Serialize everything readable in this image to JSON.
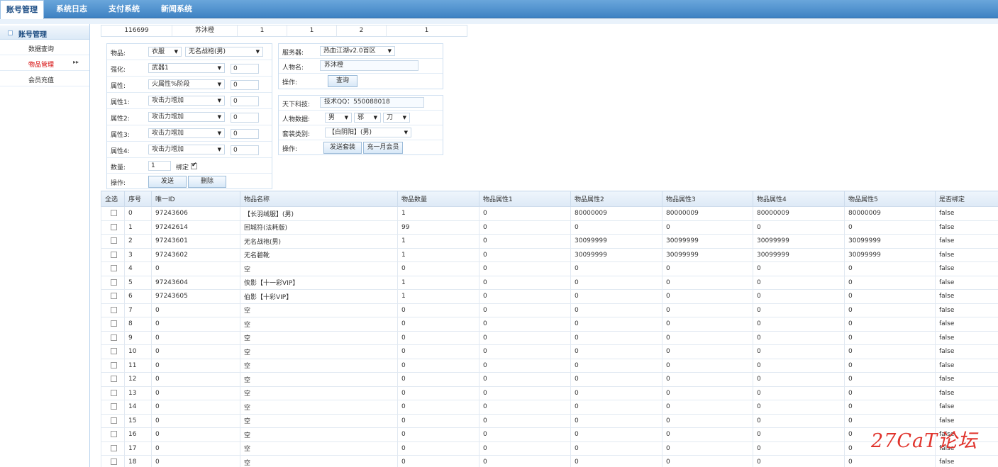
{
  "nav": {
    "tabs": [
      "账号管理",
      "系统日志",
      "支付系统",
      "新闻系统"
    ]
  },
  "sidebar": {
    "title": "账号管理",
    "items": [
      {
        "label": "数据查询"
      },
      {
        "label": "物品管理"
      },
      {
        "label": "会员充值"
      }
    ]
  },
  "info_strip": [
    "116699",
    "苏沐橙",
    "1",
    "1",
    "2",
    "1"
  ],
  "item_form": {
    "item_label": "物品:",
    "item_category": "衣服",
    "item_name": "无名战袍(男)",
    "enhance_label": "强化:",
    "enhance_select": "武器1",
    "enhance_value": "0",
    "attr_label": "属性:",
    "attr_select": "火属性%阶段",
    "attr_value": "0",
    "attr1_label": "属性1:",
    "attr1_select": "攻击力增加",
    "attr1_value": "0",
    "attr2_label": "属性2:",
    "attr2_select": "攻击力增加",
    "attr2_value": "0",
    "attr3_label": "属性3:",
    "attr3_select": "攻击力增加",
    "attr3_value": "0",
    "attr4_label": "属性4:",
    "attr4_select": "攻击力增加",
    "attr4_value": "0",
    "qty_label": "数量:",
    "qty_value": "1",
    "bind_label": "绑定",
    "bind_checked": true,
    "op_label": "操作:",
    "send_button": "发送",
    "delete_button": "删除"
  },
  "server_form": {
    "server_label": "服务器:",
    "server_value": "热血江湖v2.0首区",
    "name_label": "人物名:",
    "name_value": "苏沐橙",
    "op_label": "操作:",
    "query_button": "查询"
  },
  "suit_form": {
    "tech_label": "天下科技:",
    "tech_value": "技术QQ：550088018",
    "data_label": "人物数据:",
    "gender": "男",
    "faction": "邪",
    "weapon": "刀",
    "suit_label": "套装类别:",
    "suit_value": "【白阴阳】(男)",
    "op_label": "操作:",
    "send_suit_button": "发送套装",
    "vip_button": "充一月会员"
  },
  "table": {
    "headers": [
      "全选",
      "序号",
      "唯一ID",
      "物品名称",
      "物品数量",
      "物品属性1",
      "物品属性2",
      "物品属性3",
      "物品属性4",
      "物品属性5",
      "是否绑定"
    ],
    "rows": [
      [
        "0",
        "97243606",
        "【长羽绒服】(男)",
        "1",
        "0",
        "80000009",
        "80000009",
        "80000009",
        "80000009",
        "false"
      ],
      [
        "1",
        "97242614",
        "回城符(法耗版)",
        "99",
        "0",
        "0",
        "0",
        "0",
        "0",
        "false"
      ],
      [
        "2",
        "97243601",
        "无名战袍(男)",
        "1",
        "0",
        "30099999",
        "30099999",
        "30099999",
        "30099999",
        "false"
      ],
      [
        "3",
        "97243602",
        "无名碧靴",
        "1",
        "0",
        "30099999",
        "30099999",
        "30099999",
        "30099999",
        "false"
      ],
      [
        "4",
        "0",
        "空",
        "0",
        "0",
        "0",
        "0",
        "0",
        "0",
        "false"
      ],
      [
        "5",
        "97243604",
        "侠影【十一彩VIP】",
        "1",
        "0",
        "0",
        "0",
        "0",
        "0",
        "false"
      ],
      [
        "6",
        "97243605",
        "伯影【十彩VIP】",
        "1",
        "0",
        "0",
        "0",
        "0",
        "0",
        "false"
      ],
      [
        "7",
        "0",
        "空",
        "0",
        "0",
        "0",
        "0",
        "0",
        "0",
        "false"
      ],
      [
        "8",
        "0",
        "空",
        "0",
        "0",
        "0",
        "0",
        "0",
        "0",
        "false"
      ],
      [
        "9",
        "0",
        "空",
        "0",
        "0",
        "0",
        "0",
        "0",
        "0",
        "false"
      ],
      [
        "10",
        "0",
        "空",
        "0",
        "0",
        "0",
        "0",
        "0",
        "0",
        "false"
      ],
      [
        "11",
        "0",
        "空",
        "0",
        "0",
        "0",
        "0",
        "0",
        "0",
        "false"
      ],
      [
        "12",
        "0",
        "空",
        "0",
        "0",
        "0",
        "0",
        "0",
        "0",
        "false"
      ],
      [
        "13",
        "0",
        "空",
        "0",
        "0",
        "0",
        "0",
        "0",
        "0",
        "false"
      ],
      [
        "14",
        "0",
        "空",
        "0",
        "0",
        "0",
        "0",
        "0",
        "0",
        "false"
      ],
      [
        "15",
        "0",
        "空",
        "0",
        "0",
        "0",
        "0",
        "0",
        "0",
        "false"
      ],
      [
        "16",
        "0",
        "空",
        "0",
        "0",
        "0",
        "0",
        "0",
        "0",
        "false"
      ],
      [
        "17",
        "0",
        "空",
        "0",
        "0",
        "0",
        "0",
        "0",
        "0",
        "false"
      ],
      [
        "18",
        "0",
        "空",
        "0",
        "0",
        "0",
        "0",
        "0",
        "0",
        "false"
      ]
    ]
  },
  "watermark": "27CaT论坛",
  "colors": {
    "nav_bg": "#4a8fd0",
    "active_menu": "#d40000",
    "watermark": "#e0332c"
  }
}
